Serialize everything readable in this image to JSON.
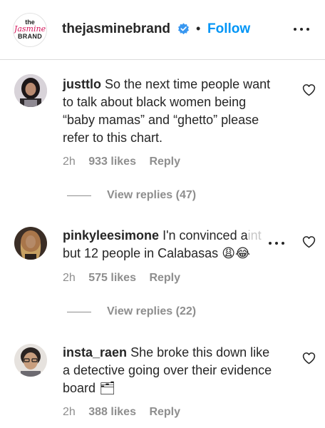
{
  "header": {
    "brand_logo": {
      "line1": "the",
      "line2": "Jasmine",
      "line3": "BRAND"
    },
    "username": "thejasminebrand",
    "separator": "•",
    "follow_label": "Follow",
    "colors": {
      "follow": "#0095f6",
      "verified": "#3897f0"
    }
  },
  "comments": [
    {
      "username": "justtlo",
      "text": "So the next time people want to talk about black women being “baby mamas” and “ghetto” please refer to this chart.",
      "time": "2h",
      "likes": "933 likes",
      "reply_label": "Reply",
      "view_replies": "View replies (47)"
    },
    {
      "username": "pinkyleesimone",
      "text_main": "I'n convinced a",
      "text_faded": "int",
      "text_line2": "but 12 people in Calabasas",
      "emojis": "😩😂",
      "time": "2h",
      "likes": "575 likes",
      "reply_label": "Reply",
      "view_replies": "View replies (22)"
    },
    {
      "username": "insta_raen",
      "text": "She broke this down like a detective going over their evidence board",
      "emoji": "🗂",
      "time": "2h",
      "likes": "388 likes",
      "reply_label": "Reply"
    }
  ]
}
